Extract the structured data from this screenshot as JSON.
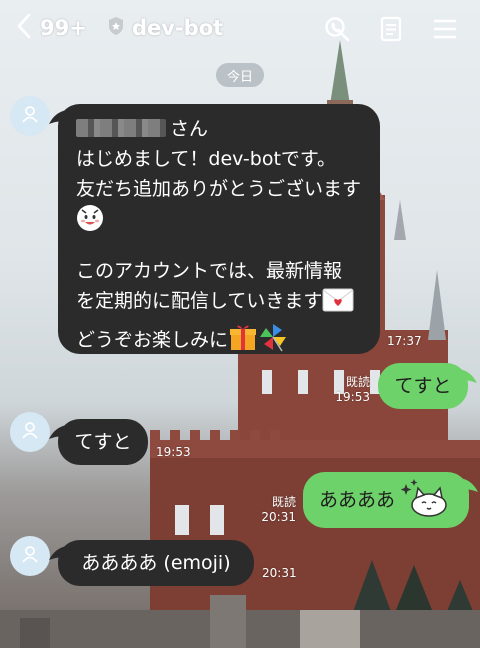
{
  "header": {
    "unread_count": "99+",
    "title": "dev-bot",
    "icons": [
      "back-chevron-icon",
      "official-shield-icon",
      "call-search-icon",
      "notes-icon",
      "menu-icon"
    ]
  },
  "date_chip": "今日",
  "messages": [
    {
      "side": "left",
      "lines": [
        "さん",
        "はじめまして！dev-botです。",
        "友だち追加ありがとうございます",
        "",
        "このアカウントでは、最新情報",
        "を定期的に配信していきます",
        "どうぞお楽しみに"
      ],
      "time": "17:37"
    },
    {
      "side": "right",
      "text": "てすと",
      "read": "既読",
      "time": "19:53"
    },
    {
      "side": "left",
      "text": "てすと",
      "time": "19:53"
    },
    {
      "side": "right",
      "text": "ああああ",
      "read": "既読",
      "time": "20:31"
    },
    {
      "side": "left",
      "text": "ああああ (emoji)",
      "time": "20:31"
    }
  ],
  "colors": {
    "left_bubble": "#2b2b2b",
    "right_bubble": "#6ed26a",
    "avatar_bg": "#d5e8f4"
  }
}
